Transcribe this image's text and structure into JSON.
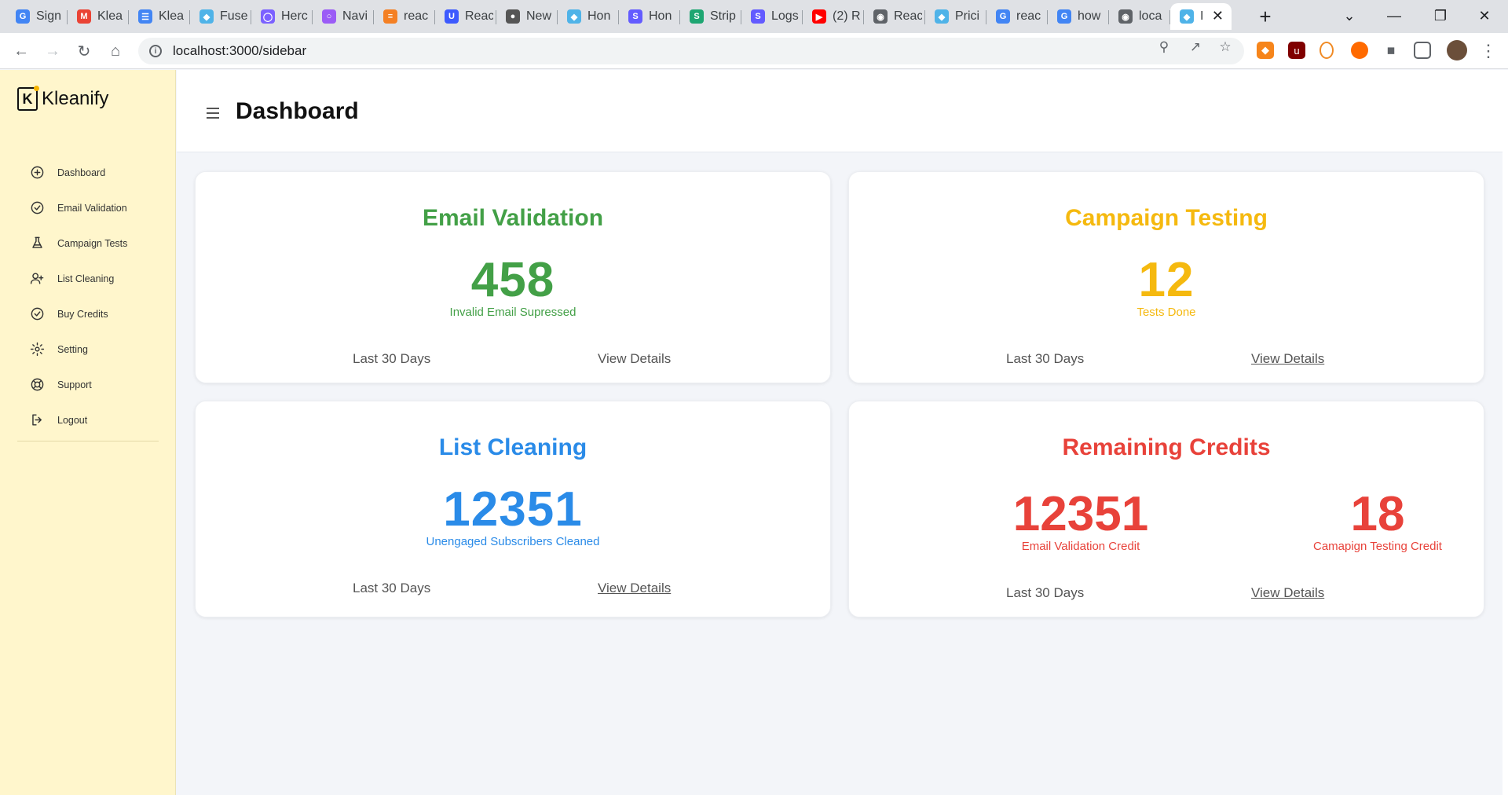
{
  "browser": {
    "tabs": [
      {
        "label": "Sign",
        "icon": "google-icon",
        "color": "#4285f4"
      },
      {
        "label": "Klea",
        "icon": "gmail-icon",
        "color": "#ea4335"
      },
      {
        "label": "Klea",
        "icon": "docs-icon",
        "color": "#4285f4"
      },
      {
        "label": "Fuse",
        "icon": "diamond-icon",
        "color": "#4fb3e8"
      },
      {
        "label": "Herc",
        "icon": "shield-icon",
        "color": "#7b61ff"
      },
      {
        "label": "Navi",
        "icon": "swirl-icon",
        "color": "#9b5cf6"
      },
      {
        "label": "reac",
        "icon": "stack-icon",
        "color": "#f48024"
      },
      {
        "label": "Reac",
        "icon": "u-icon",
        "color": "#3d5afe"
      },
      {
        "label": "New",
        "icon": "github-icon",
        "color": "#555555"
      },
      {
        "label": "Hon",
        "icon": "diamond-icon",
        "color": "#4fb3e8"
      },
      {
        "label": "Hon",
        "icon": "s-icon",
        "color": "#635bff"
      },
      {
        "label": "Strip",
        "icon": "s-icon",
        "color": "#1ea672"
      },
      {
        "label": "Logs",
        "icon": "s-icon",
        "color": "#635bff"
      },
      {
        "label": "(2) R",
        "icon": "youtube-icon",
        "color": "#ff0000"
      },
      {
        "label": "Reac",
        "icon": "globe-icon",
        "color": "#5f6368"
      },
      {
        "label": "Prici",
        "icon": "diamond-icon",
        "color": "#4fb3e8"
      },
      {
        "label": "reac",
        "icon": "google-icon",
        "color": "#4285f4"
      },
      {
        "label": "how",
        "icon": "google-icon",
        "color": "#4285f4"
      },
      {
        "label": "loca",
        "icon": "globe-icon",
        "color": "#5f6368"
      }
    ],
    "active_tab": {
      "label": "I",
      "icon": "diamond-icon",
      "color": "#4fb3e8"
    },
    "url": "localhost:3000/sidebar"
  },
  "app": {
    "brand": "Kleanify",
    "brand_letter": "K",
    "page_title": "Dashboard",
    "nav": [
      {
        "label": "Dashboard",
        "icon": "plus-circle-icon"
      },
      {
        "label": "Email Validation",
        "icon": "check-circle-icon"
      },
      {
        "label": "Campaign Tests",
        "icon": "flask-icon"
      },
      {
        "label": "List Cleaning",
        "icon": "user-plus-icon"
      },
      {
        "label": "Buy Credits",
        "icon": "check-circle-icon"
      },
      {
        "label": "Setting",
        "icon": "gear-icon"
      },
      {
        "label": "Support",
        "icon": "lifebuoy-icon"
      },
      {
        "label": "Logout",
        "icon": "logout-icon"
      }
    ]
  },
  "cards": {
    "email_validation": {
      "title": "Email Validation",
      "value": "458",
      "subtitle": "Invalid Email Supressed",
      "period": "Last 30 Days",
      "link": "View Details",
      "color": "#43a047"
    },
    "campaign_testing": {
      "title": "Campaign Testing",
      "value": "12",
      "subtitle": "Tests Done",
      "period": "Last 30 Days",
      "link": "View Details",
      "color": "#f5b90f"
    },
    "list_cleaning": {
      "title": "List Cleaning",
      "value": "12351",
      "subtitle": "Unengaged Subscribers Cleaned",
      "period": "Last 30 Days",
      "link": "View Details",
      "color": "#2a8be8"
    },
    "remaining_credits": {
      "title": "Remaining Credits",
      "email_value": "12351",
      "email_label": "Email Validation Credit",
      "campaign_value": "18",
      "campaign_label": "Camapign Testing Credit",
      "period": "Last 30 Days",
      "link": "View Details",
      "color": "#e8423a"
    }
  }
}
